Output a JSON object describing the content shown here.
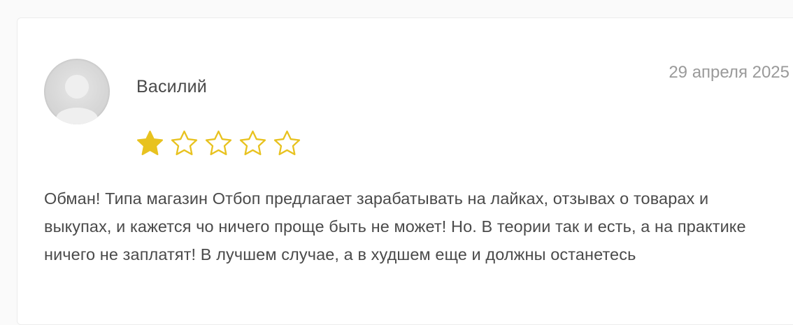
{
  "review": {
    "author": "Василий",
    "date": "29 апреля 2025",
    "rating": 1,
    "max_rating": 5,
    "text": "Обман! Типа магазин Отбоп предлагает зарабатывать на лайках, отзывах о товарах и выкупах, и кажется чо ничего проще быть не может! Но. В теории так и есть, а на практике ничего не заплатят! В лучшем случае, а в худшем еще и должны останетесь"
  },
  "colors": {
    "star": "#e8c21f",
    "text": "#4a4a4a",
    "date": "#9a9a9a"
  },
  "icons": {
    "avatar": "user-placeholder-icon",
    "star_filled": "star-filled-icon",
    "star_empty": "star-outline-icon"
  }
}
